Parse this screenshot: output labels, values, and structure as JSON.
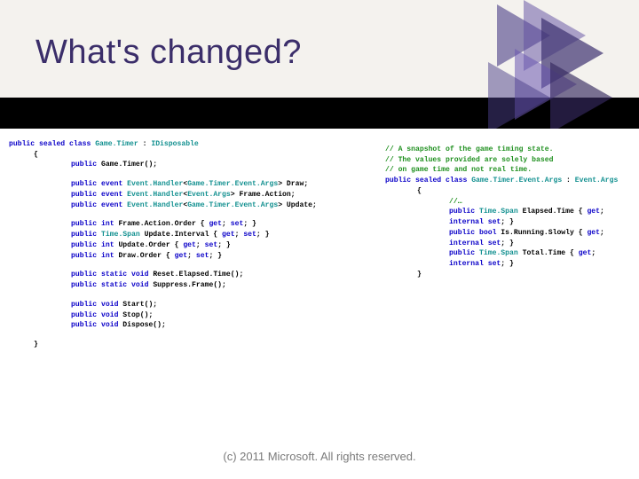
{
  "title": "What's changed?",
  "footer": "(c) 2011 Microsoft. All rights reserved.",
  "code_left": {
    "l1a": "public",
    "l1b": "sealed",
    "l1c": "class",
    "l1d": "Game.Timer",
    "l1e": " : ",
    "l1f": "IDisposable",
    "l2": "{",
    "l3a": "public",
    "l3b": " Game.Timer();",
    "l4a": "public",
    "l4b": "event",
    "l4c": "Event.Handler",
    "l4d": "Game.Timer.Event.Args",
    "l4e": "> Draw;",
    "l5a": "public",
    "l5b": "event",
    "l5c": "Event.Handler",
    "l5d": "Event.Args",
    "l5e": "> Frame.Action;",
    "l6a": "public",
    "l6b": "event",
    "l6c": "Event.Handler",
    "l6d": "Game.Timer.Event.Args",
    "l6e": "> Update;",
    "l7a": "public",
    "l7b": "int",
    "l7c": " Frame.Action.Order { ",
    "l7d": "get",
    "l7e": "set",
    "l7f": "; }",
    "l8a": "public",
    "l8b": "Time.Span",
    "l8c": " Update.Interval { ",
    "l8d": "get",
    "l8e": "set",
    "l8f": "; }",
    "l9a": "public",
    "l9b": "int",
    "l9c": " Update.Order { ",
    "l9d": "get",
    "l9e": "set",
    "l9f": "; }",
    "l10a": "public",
    "l10b": "int",
    "l10c": " Draw.Order { ",
    "l10d": "get",
    "l10e": "set",
    "l10f": "; }",
    "l11a": "public",
    "l11b": "static",
    "l11c": "void",
    "l11d": " Reset.Elapsed.Time();",
    "l12a": "public",
    "l12b": "static",
    "l12c": "void",
    "l12d": " Suppress.Frame();",
    "l13a": "public",
    "l13b": "void",
    "l13c": " Start();",
    "l14a": "public",
    "l14b": "void",
    "l14c": " Stop();",
    "l15a": "public",
    "l15b": "void",
    "l15c": " Dispose();",
    "l16": "}"
  },
  "code_right": {
    "r1": "// A snapshot of the game timing state.",
    "r2": "// The values provided are solely based",
    "r3": "// on game time and not real time.",
    "r4a": "public",
    "r4b": "sealed",
    "r4c": "class",
    "r4d": "Game.Timer.Event.Args",
    "r4e": " : ",
    "r4f": "Event.Args",
    "r5": "{",
    "r6": "//…",
    "r7a": "public",
    "r7b": "Time.Span",
    "r7c": " Elapsed.Time { ",
    "r7d": "get",
    "r7e": "internal",
    "r7f": "set",
    "r7g": "; }",
    "r8a": "public",
    "r8b": "bool",
    "r8c": " Is.Running.Slowly { ",
    "r8d": "get",
    "r8e": "internal",
    "r8f": "set",
    "r8g": "; }",
    "r9a": "public",
    "r9b": "Time.Span",
    "r9c": " Total.Time { ",
    "r9d": "get",
    "r9e": "internal",
    "r9f": "set",
    "r9g": "; }",
    "r10": "}"
  }
}
